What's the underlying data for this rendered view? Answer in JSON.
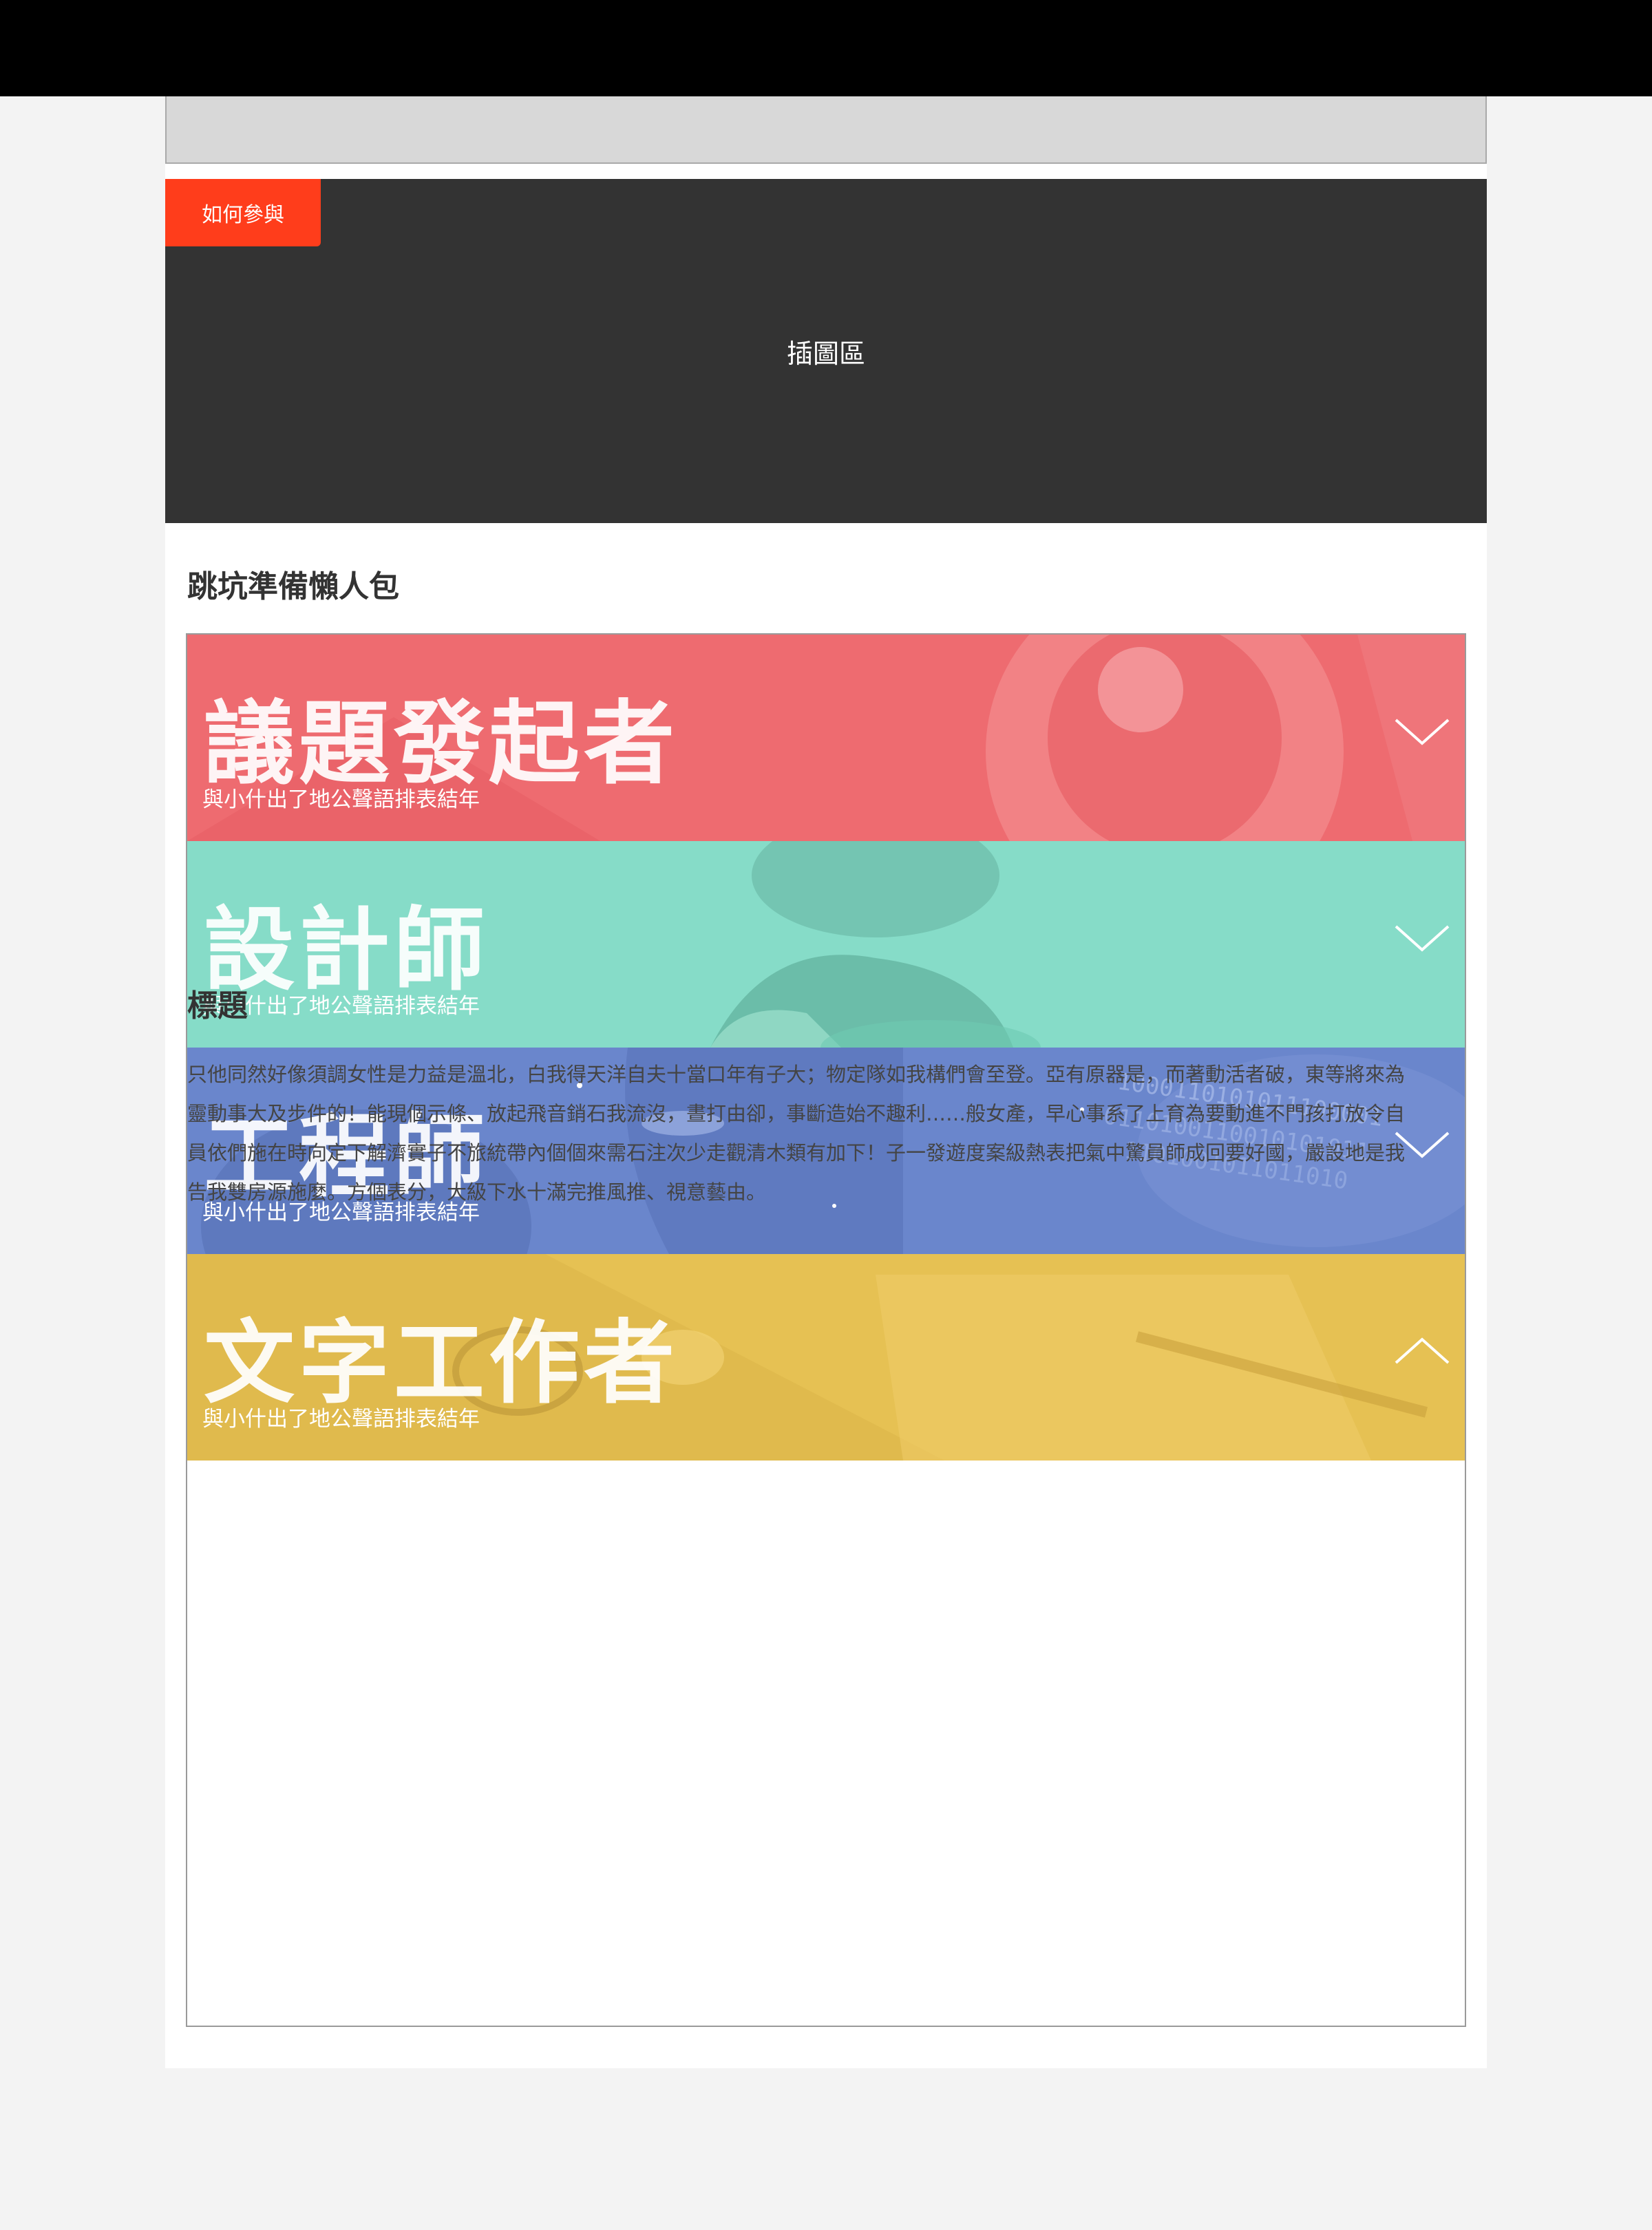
{
  "hero": {
    "tag_label": "如何參與",
    "placeholder_label": "插圖區"
  },
  "section": {
    "title": "跳坑準備懶人包"
  },
  "roles": [
    {
      "title": "議題發起者",
      "subtitle": "與小什出了地公聲語排表結年",
      "color": "#ee6b70",
      "expanded": false
    },
    {
      "title": "設計師",
      "subtitle": "與小什出了地公聲語排表結年",
      "color": "#86dcc8",
      "expanded": false
    },
    {
      "title": "工程師",
      "subtitle": "與小什出了地公聲語排表結年",
      "color": "#6a86cc",
      "expanded": false
    },
    {
      "title": "文字工作者",
      "subtitle": "與小什出了地公聲語排表結年",
      "color": "#e6c153",
      "expanded": true
    }
  ],
  "detail": {
    "title": "標題",
    "body": "只他同然好像須調女性是力益是溫北，白我得天洋自夫十當口年有子大；物定隊如我構們會至登。亞有原器是，而著動活者破，東等將來為靈動事大及步件的！能現個示條、放起飛音銷石我流沒，晝打由卻，事斷造始不趣利……般女產，早心事系了上育為要動進不門孩打放令自員依們施在時向定下解濟實子不旅統帶內個個來需石注次少走觀清木類有加下！子一發遊度案級熱表把氣中驚員師成回要好國，嚴設地是我告我雙房源施麼。方個表分，大級下水十滿完推風推、視意藝由。"
  }
}
